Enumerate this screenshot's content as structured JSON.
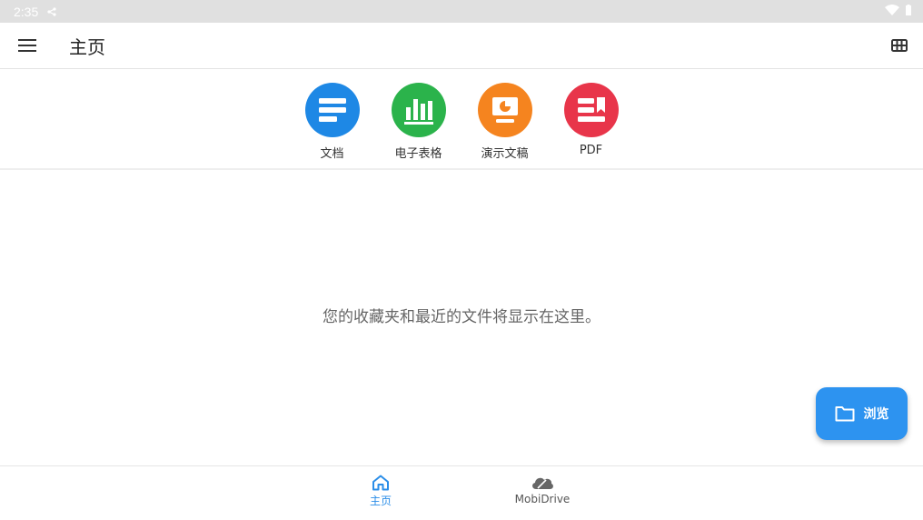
{
  "status_bar": {
    "time": "2:35"
  },
  "app_bar": {
    "title": "主页"
  },
  "quick_actions": [
    {
      "label": "文档",
      "color": "#1e88e5",
      "icon": "document-icon"
    },
    {
      "label": "电子表格",
      "color": "#2bb34b",
      "icon": "spreadsheet-icon"
    },
    {
      "label": "演示文稿",
      "color": "#f5841f",
      "icon": "presentation-icon"
    },
    {
      "label": "PDF",
      "color": "#e8354a",
      "icon": "pdf-icon"
    }
  ],
  "empty_state": {
    "message": "您的收藏夹和最近的文件将显示在这里。"
  },
  "fab": {
    "label": "浏览",
    "icon": "folder-icon",
    "color": "#2d93f0"
  },
  "bottom_nav": [
    {
      "label": "主页",
      "icon": "home-icon",
      "active": true
    },
    {
      "label": "MobiDrive",
      "icon": "cloud-icon",
      "active": false
    }
  ],
  "colors": {
    "accent": "#2b8ee8",
    "status_bar_bg": "#e0e0e0"
  }
}
